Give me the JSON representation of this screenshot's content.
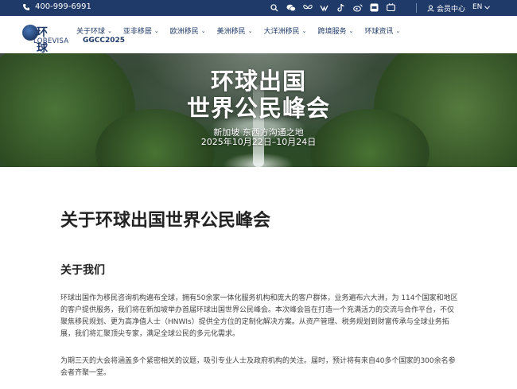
{
  "topbar": {
    "phone": "400-999-6991",
    "icons": [
      "search-icon",
      "wechat-icon",
      "butterfly-icon",
      "weixin-channels-icon",
      "tiktok-icon",
      "weibo-icon",
      "xiaohongshu-icon",
      "video-icon"
    ],
    "member_center": "会员中心",
    "language": "EN"
  },
  "logo": {
    "cn": "环 球",
    "en": "LOBEVISA",
    "sub": "GGCC2025"
  },
  "nav": {
    "items": [
      {
        "label": "关于环球"
      },
      {
        "label": "亚非移居"
      },
      {
        "label": "欧洲移民"
      },
      {
        "label": "美洲移民"
      },
      {
        "label": "大洋洲移民"
      },
      {
        "label": "跨境服务"
      },
      {
        "label": "环球资讯"
      }
    ]
  },
  "hero": {
    "title_line1": "环球出国",
    "title_line2": "世界公民峰会",
    "subtitle_line1": "新加坡 东西方沟通之地",
    "subtitle_line2": "2025年10月22日–10月24日"
  },
  "main": {
    "heading": "关于环球出国世界公民峰会",
    "section_title": "关于我们",
    "paragraph1": "环球出国作为移民咨询机构遍布全球，拥有50余家一体化服务机构和庞大的客户群体，业务遍布六大洲，为 114个国家和地区的客户提供服务，我们将在新加坡举办首届环球出国世界公民峰会。本次峰会旨在打造一个充满活力的交流与合作平台，不仅聚焦移民规划、更为高净值人士（HNWIs）提供全方位的定制化解决方案。从资产管理、税务规划到财富传承与全球业务拓展，我们将汇聚顶尖专家，满足全球公民的多元化需求。",
    "paragraph2": "为期三天的大会将涵盖多个紧密相关的议题，吸引专业人士及政府机构的关注。届时，预计将有来自40多个国家的300余名参会者齐聚一堂。"
  },
  "colors": {
    "brand": "#1f3a68",
    "text": "#222222"
  }
}
